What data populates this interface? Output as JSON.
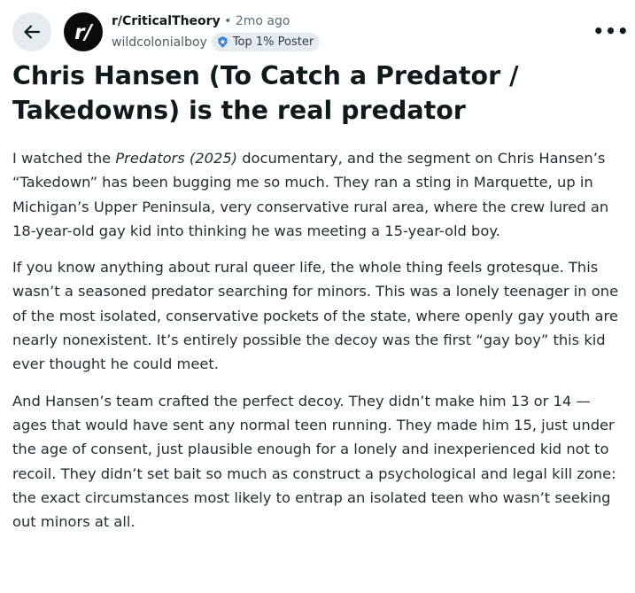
{
  "header": {
    "subreddit": "r/CriticalTheory",
    "separator": "•",
    "age": "2mo ago",
    "username": "wildcolonialboy",
    "badge": "Top 1% Poster",
    "more_label": "•••",
    "avatar_text": "r/"
  },
  "post": {
    "title": "Chris Hansen (To Catch a Predator / Takedowns) is the real predator",
    "p1": {
      "pre": "I watched the ",
      "italic": "Predators (2025)",
      "post": " documentary, and the segment on Chris Hansen’s “Takedown” has been bugging me so much. They ran a sting in Marquette, up in Michigan’s Upper Peninsula, very conservative rural area, where the crew lured an 18-year-old gay kid into thinking he was meeting a 15-year-old boy."
    },
    "p2": "If you know anything about rural queer life, the whole thing feels grotesque. This wasn’t a seasoned predator searching for minors. This was a lonely teenager in one of the most isolated, conservative pockets of the state, where openly gay youth are nearly nonexistent. It’s entirely possible the decoy was the first “gay boy” this kid ever thought he could meet.",
    "p3": "And Hansen’s team crafted the perfect decoy. They didn’t make him 13 or 14 — ages that would have sent any normal teen running. They made him 15, just under the age of consent, just plausible enough for a lonely and inexperienced kid not to recoil. They didn’t set bait so much as construct a psychological and legal kill zone: the exact circumstances most likely to entrap an isolated teen who wasn’t seeking out minors at all."
  },
  "icons": {
    "back": "arrow-left-icon",
    "badge": "top-poster-badge-icon",
    "more": "more-options-icon"
  },
  "colors": {
    "text": "#0f1a1c",
    "muted": "#576f76",
    "pill_bg": "#e5ebee",
    "avatar_bg": "#0b0b0b",
    "badge_accent": "#3d7fd6"
  }
}
